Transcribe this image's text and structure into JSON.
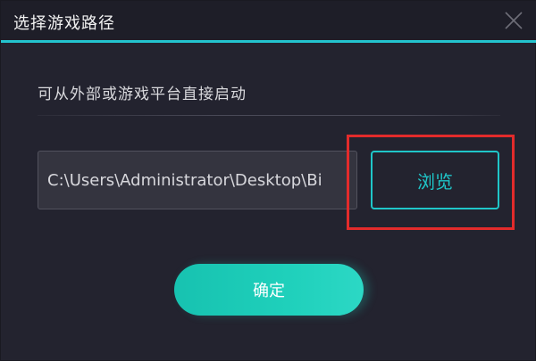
{
  "dialog": {
    "title": "选择游戏路径",
    "subtitle": "可从外部或游戏平台直接启动",
    "path_value": "C:\\Users\\Administrator\\Desktop\\Bi",
    "browse_label": "浏览",
    "confirm_label": "确定",
    "close_icon": "close-icon"
  },
  "colors": {
    "accent": "#23c4cf",
    "button_teal": "#1fc6c9",
    "confirm_green": "#1fd0bb",
    "highlight_red": "#e32b2b",
    "background": "#23232f"
  }
}
